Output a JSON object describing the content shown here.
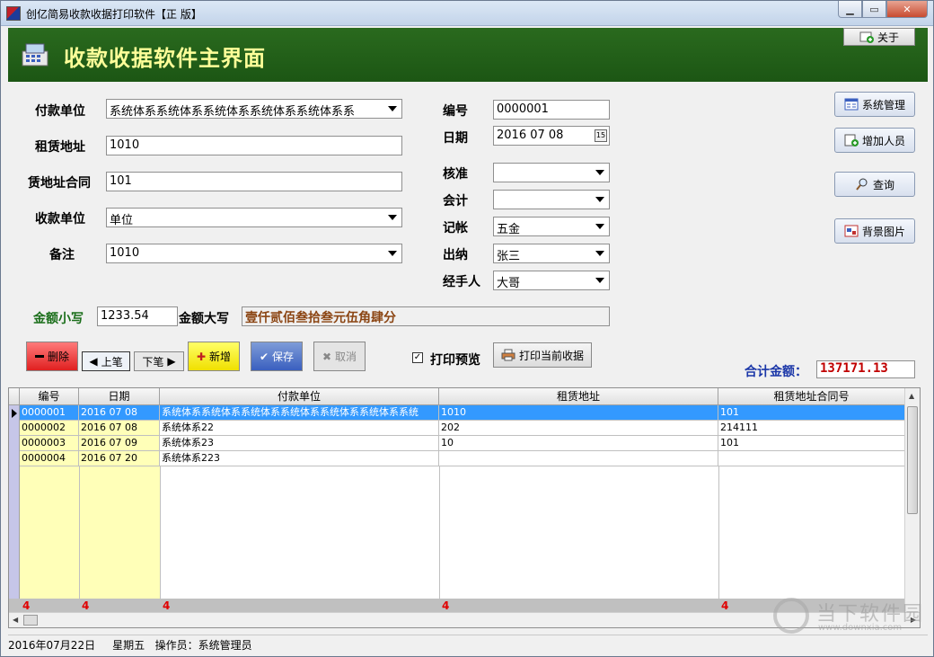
{
  "window": {
    "title": "创亿简易收款收据打印软件【正 版】"
  },
  "banner": {
    "title": "收款收据软件主界面",
    "about_label": "关于"
  },
  "form": {
    "payer_label": "付款单位",
    "payer_value": "系统体系系统体系系统体系系统体系系统体系系",
    "rent_addr_label": "租赁地址",
    "rent_addr_value": "1010",
    "contract_label": "赁地址合同",
    "contract_value": "101",
    "receiver_label": "收款单位",
    "receiver_value": "单位",
    "remark_label": "备注",
    "remark_value": "1010",
    "no_label": "编号",
    "no_value": "0000001",
    "date_label": "日期",
    "date_value": "2016   07   08",
    "approve_label": "核准",
    "approve_value": "",
    "accountant_label": "会计",
    "accountant_value": "",
    "bookkeep_label": "记帐",
    "bookkeep_value": "五金",
    "cashier_label": "出纳",
    "cashier_value": "张三",
    "handler_label": "经手人",
    "handler_value": "大哥",
    "amount_small_label": "金额小写",
    "amount_small_value": "1233.54",
    "amount_big_label": "金额大写",
    "amount_big_value": "壹仟贰佰叁拾叁元伍角肆分"
  },
  "side_buttons": {
    "sys_manage": "系统管理",
    "add_person": "增加人员",
    "query": "查询",
    "bg_image": "背景图片"
  },
  "actions": {
    "delete": "删除",
    "prev": "上笔",
    "next": "下笔",
    "add": "新增",
    "save": "保存",
    "cancel": "取消",
    "print_preview": "打印预览",
    "print_current": "打印当前收据",
    "total_label": "合计金额：",
    "total_value": "137171.13"
  },
  "grid": {
    "headers": [
      "编号",
      "日期",
      "付款单位",
      "租赁地址",
      "租赁地址合同号"
    ],
    "rows": [
      [
        "0000001",
        "2016   07   08",
        "系统体系系统体系系统体系系统体系系统体系系统体系系统",
        "1010",
        "101"
      ],
      [
        "0000002",
        "2016   07   08",
        "系统体系22",
        "202",
        "214111"
      ],
      [
        "0000003",
        "2016   07   09",
        "系统体系23",
        "10",
        "101"
      ],
      [
        "0000004",
        "2016   07   20",
        "系统体系223",
        "",
        ""
      ]
    ],
    "footer": [
      "4",
      "4",
      "4",
      "4",
      "4"
    ]
  },
  "status": {
    "date": "2016年07月22日",
    "weekday": "星期五",
    "operator": "操作员：系统管理员"
  },
  "watermark": {
    "main": "当下软件园",
    "sub": "www.downxia.com"
  }
}
